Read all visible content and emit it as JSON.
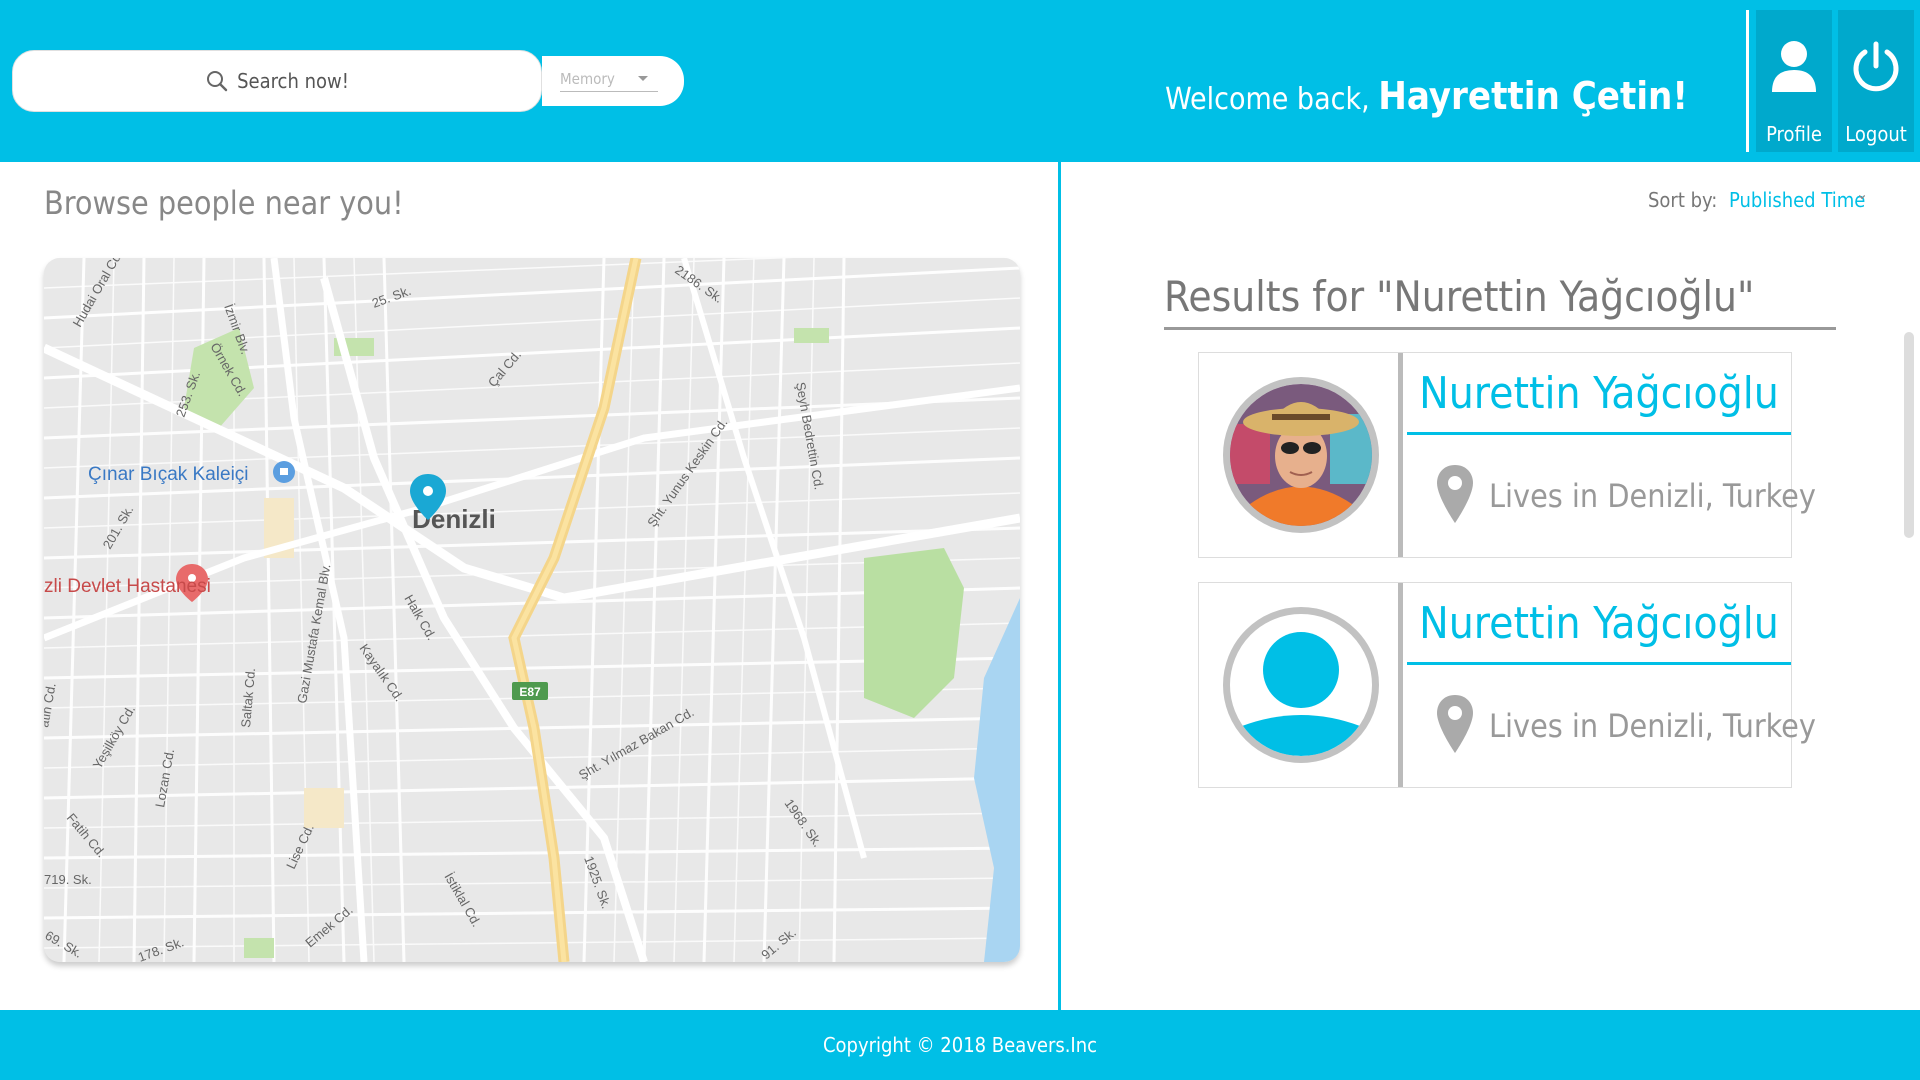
{
  "header": {
    "search_label": "Search now!",
    "category_value": "Memory",
    "welcome_text": "Welcome back,",
    "user_name": "Hayrettin Çetin!",
    "profile_label": "Profile",
    "logout_label": "Logout",
    "accent_color": "#00bfe6"
  },
  "left": {
    "title": "Browse people near you!",
    "map": {
      "city": "Denizli",
      "poi_1": "Çınar Bıçak Kaleiçi",
      "poi_2": "zli Devlet Hastanesi",
      "highway": "E87",
      "streets": [
        "Hudai Oral Cd.",
        "İzmir Blv.",
        "Örnek Cd.",
        "253. Sk.",
        "25. Sk.",
        "Çal Cd.",
        "2186. Sk.",
        "Şht. Yunus Keskin Cd.",
        "Şeyh Bedrettin Cd.",
        "201. Sk.",
        "Halk Cd.",
        "Gazi Mustafa Kemal Blv.",
        "Kayalık Cd.",
        "Saltak Cd.",
        "Yeşilköy Cd.",
        "Lozan Cd.",
        "Fatih Cd.",
        "Lise Cd.",
        "İstiklal Cd.",
        "Emek Cd.",
        "1925. Sk.",
        "Şht. Yılmaz Bakan Cd.",
        "1968. Sk.",
        "719. Sk.",
        "178. Sk.",
        "69. Sk.",
        "91. Sk.",
        "atih Cd."
      ]
    }
  },
  "right": {
    "sort_label": "Sort by:",
    "sort_value": "Published Time",
    "results_title": "Results for \"Nurettin Yağcıoğlu\"",
    "results": [
      {
        "name": "Nurettin Yağcıoğlu",
        "location": "Lives in Denizli, Turkey"
      },
      {
        "name": "Nurettin Yağcıoğlu",
        "location": "Lives in Denizli, Turkey"
      }
    ]
  },
  "footer": {
    "copyright": "Copyright © 2018 Beavers.Inc"
  }
}
